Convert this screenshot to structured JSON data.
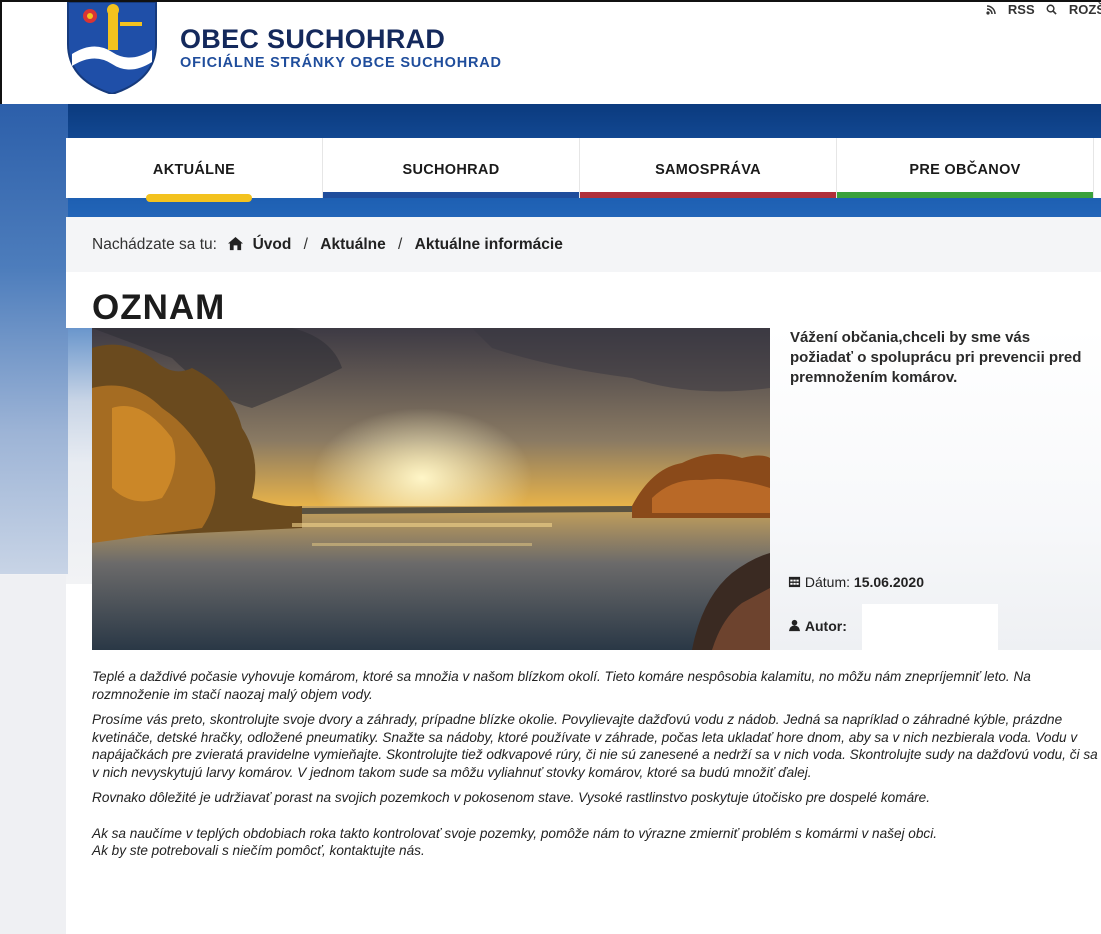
{
  "header": {
    "title": "OBEC SUCHOHRAD",
    "subtitle": "OFICIÁLNE STRÁNKY OBCE SUCHOHRAD",
    "top_links": {
      "rss": "RSS",
      "search": "ROZŠ"
    }
  },
  "nav": {
    "items": [
      {
        "label": "AKTUÁLNE",
        "color": "#f3c21e",
        "active": true
      },
      {
        "label": "SUCHOHRAD",
        "color": "#1f4d9c"
      },
      {
        "label": "SAMOSPRÁVA",
        "color": "#b0303a"
      },
      {
        "label": "PRE OBČANOV",
        "color": "#3aa13a"
      }
    ]
  },
  "breadcrumb": {
    "prefix": "Nachádzate sa tu:",
    "items": [
      "Úvod",
      "Aktuálne",
      "Aktuálne informácie"
    ],
    "separator": "/"
  },
  "article": {
    "title": "OZNAM",
    "lead": "Vážení občania,chceli by sme vás požiadať o spoluprácu pri prevencii pred premnožením komárov.",
    "date_label": "Dátum:",
    "date_value": "15.06.2020",
    "author_label": "Autor:",
    "paragraphs": [
      "Teplé a daždivé počasie vyhovuje komárom, ktoré sa množia v našom blízkom okolí. Tieto komáre nespôsobia kalamitu, no môžu nám znepríjemniť leto. Na rozmnoženie im stačí naozaj malý objem vody.",
      "Prosíme vás preto, skontrolujte svoje dvory a záhrady, prípadne blízke okolie. Povylievajte dažďovú vodu z nádob. Jedná sa napríklad o záhradné kýble, prázdne kvetináče, detské hračky, odložené pneumatiky. Snažte sa nádoby, ktoré používate v záhrade, počas leta ukladať hore dnom, aby sa v nich nezbierala voda. Vodu v napájačkách pre zvieratá pravidelne vymieňajte. Skontrolujte tiež odkvapové rúry, či nie sú zanesené a nedrží sa v nich voda. Skontrolujte sudy na dažďovú vodu, či sa v nich nevyskytujú larvy komárov. V jednom takom sude sa môžu vyliahnuť stovky komárov, ktoré sa budú množiť ďalej.",
      "Rovnako dôležité je udržiavať porast na svojich pozemkoch v pokosenom stave. Vysoké rastlinstvo poskytuje útočisko pre dospelé komáre.",
      "Ak sa naučíme v teplých obdobiach roka takto kontrolovať svoje pozemky, pomôže nám to výrazne zmierniť problém s komármi v našej obci.",
      "Ak by ste potrebovali s niečím pomôcť, kontaktujte nás."
    ]
  },
  "icons": {
    "crest": "coat-of-arms-icon",
    "rss": "rss-icon",
    "search": "search-icon",
    "home": "home-icon",
    "calendar": "calendar-icon",
    "user": "user-icon"
  }
}
